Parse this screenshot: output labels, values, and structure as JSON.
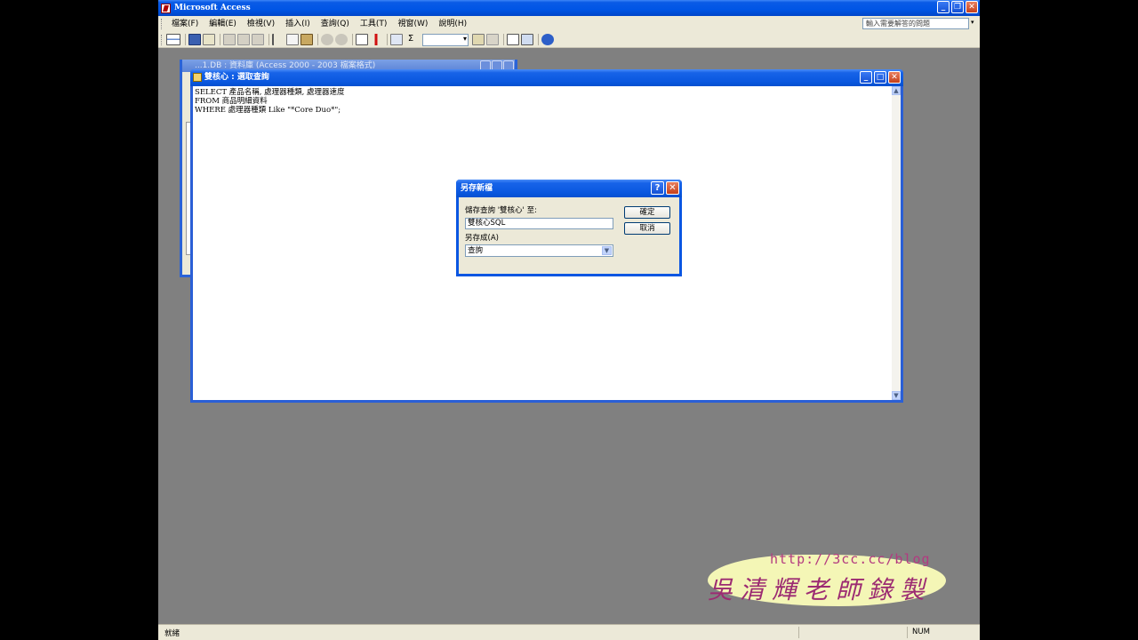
{
  "app": {
    "title": "Microsoft Access",
    "caption_buttons": {
      "minimize": "_",
      "restore": "❐",
      "close": "✕"
    }
  },
  "menu": {
    "items": [
      "檔案(F)",
      "編輯(E)",
      "檢視(V)",
      "插入(I)",
      "查詢(Q)",
      "工具(T)",
      "視窗(W)",
      "說明(H)"
    ],
    "help_placeholder": "輸入需要解答的問題"
  },
  "toolbar": {
    "icons": [
      "view-icon",
      "save-icon",
      "search-file-icon",
      "print-icon",
      "print-preview-icon",
      "spellcheck-icon",
      "cut-icon",
      "copy-icon",
      "paste-icon",
      "undo-icon",
      "redo-icon",
      "query-type-icon",
      "run-icon",
      "show-table-icon",
      "totals-icon",
      "properties-icon",
      "build-icon",
      "database-window-icon",
      "new-object-icon",
      "help-icon"
    ]
  },
  "back_window": {
    "title": "...1.DB : 資料庫 (Access 2000 - 2003 檔案格式)"
  },
  "sql_window": {
    "title": "雙核心 : 選取查詢",
    "sql_lines": [
      "SELECT 產品名稱, 處理器種類, 處理器速度",
      "FROM 商品明細資料",
      "WHERE 處理器種類 Like \"*Core Duo*\";"
    ]
  },
  "dialog": {
    "title": "另存新檔",
    "help_button": "?",
    "close_button": "✕",
    "save_label": "儲存查詢 '雙核心' 至:",
    "name_value": "雙核心SQL",
    "save_as_label": "另存成(A)",
    "type_value": "查詢",
    "ok_label": "確定",
    "cancel_label": "取消"
  },
  "watermark": {
    "url": "http://3cc.cc/blog",
    "name": "吳清輝老師錄製"
  },
  "status": {
    "text": "就緒",
    "num": "NUM"
  },
  "colors": {
    "title_blue": "#0055e5",
    "face": "#ece9d8",
    "mdi_gray": "#808080"
  }
}
